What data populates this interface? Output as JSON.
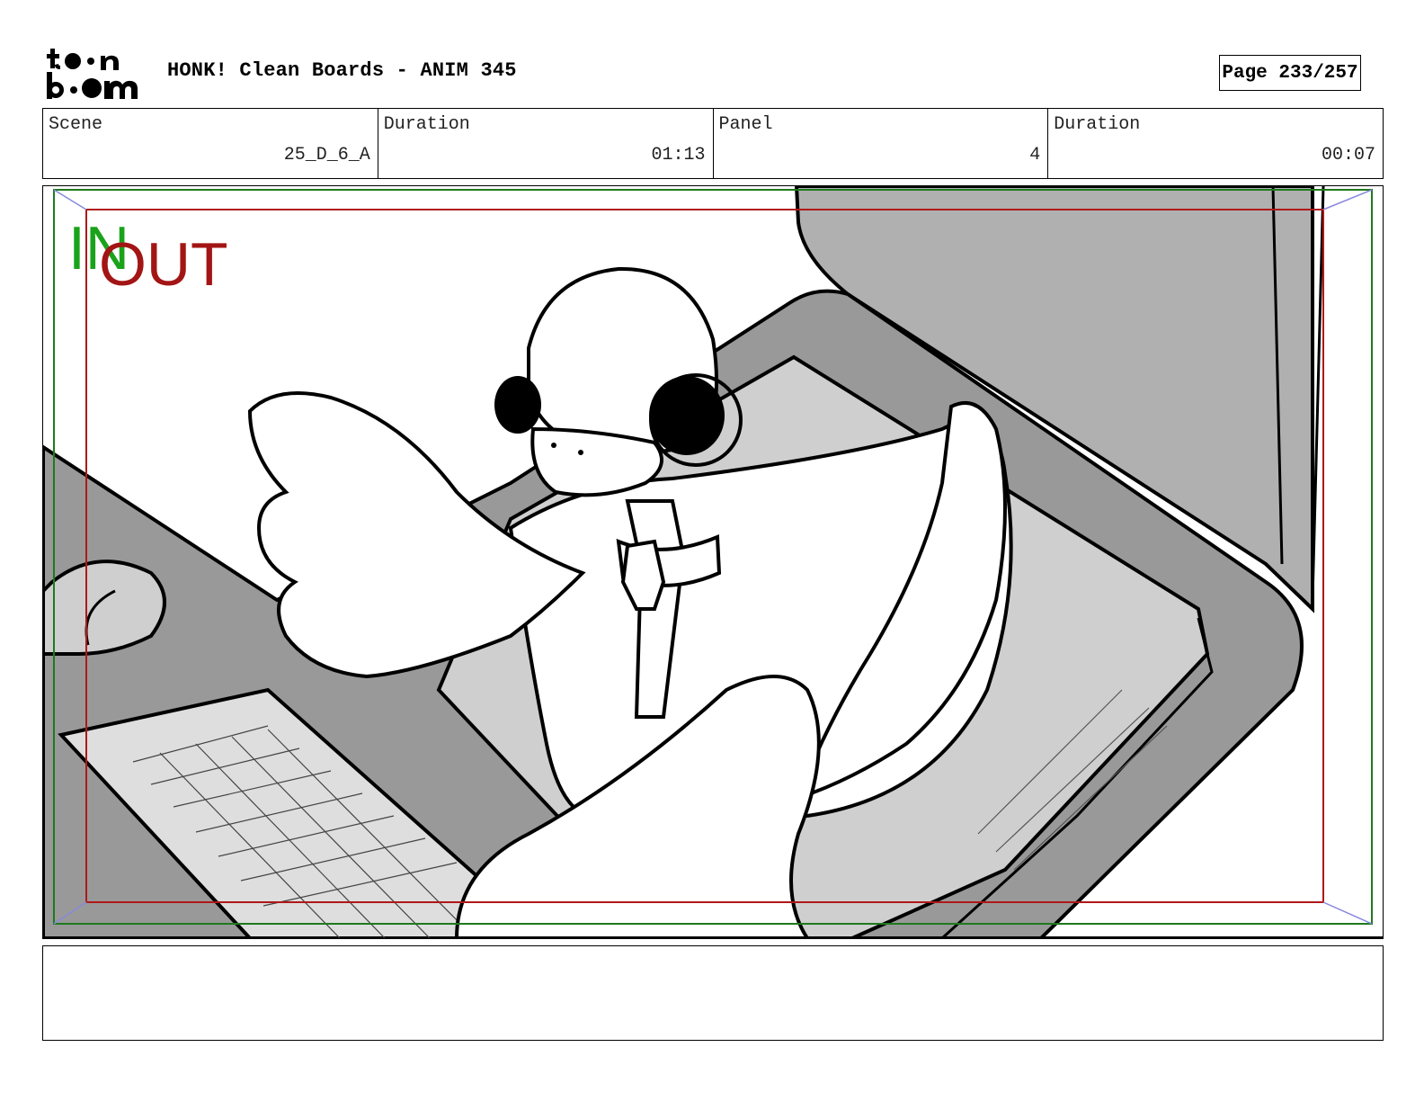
{
  "header": {
    "logo_text": "toon boom",
    "title": "HONK! Clean Boards - ANIM 345",
    "page": "Page 233/257"
  },
  "info": {
    "scene_label": "Scene",
    "scene_value": "25_D_6_A",
    "scene_duration_label": "Duration",
    "scene_duration_value": "01:13",
    "panel_label": "Panel",
    "panel_value": "4",
    "panel_duration_label": "Duration",
    "panel_duration_value": "00:07"
  },
  "panel": {
    "in_label": "IN",
    "out_label": "OUT",
    "in_color": "#1aa31a",
    "out_color": "#a31515"
  },
  "notes": {
    "text": ""
  }
}
